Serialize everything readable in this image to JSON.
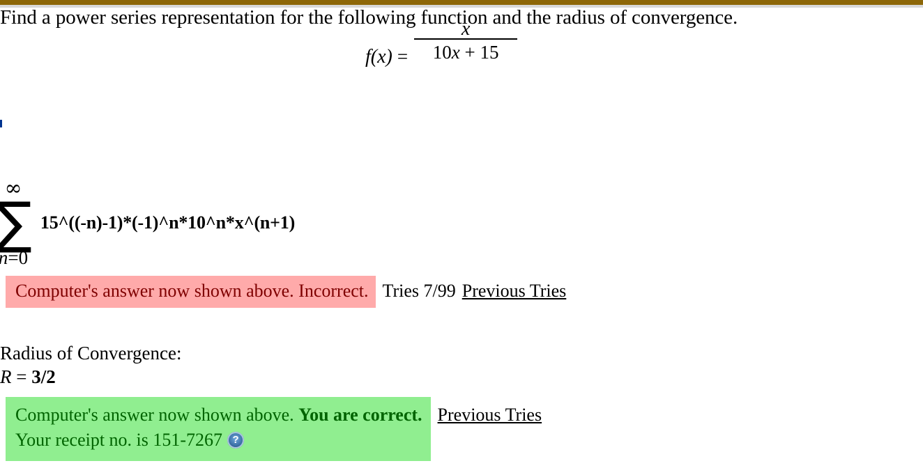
{
  "theme": {
    "top_bar_color": "#8d6708",
    "incorrect_bg": "#ffaaaa",
    "incorrect_text": "#7f0000",
    "correct_bg": "#90ee90",
    "correct_text": "#006400",
    "page_bg": "#ffffff"
  },
  "problem": {
    "prompt": "Find a power series representation for the following function and the radius of convergence.",
    "equation": {
      "lhs": "f(x)",
      "equals": "=",
      "numerator": "x",
      "denominator_coefficient": "10",
      "denominator_variable": "x",
      "denominator_plus": "+",
      "denominator_constant": "15"
    }
  },
  "answer_series": {
    "sigma_glyph": "∑",
    "upper_limit": "∞",
    "lower_index": "n",
    "lower_equals": "=",
    "lower_start": "0",
    "expression": "15^((-n)-1)*(-1)^n*10^n*x^(n+1)"
  },
  "incorrect_feedback": {
    "message": "Computer's answer now shown above. Incorrect.",
    "tries_label": "Tries 7/99",
    "previous_tries_link": "Previous Tries"
  },
  "radius_of_convergence": {
    "label": "Radius of Convergence:",
    "variable": "R",
    "equals": "=",
    "value": "3/2"
  },
  "correct_feedback": {
    "message_prefix": "Computer's answer now shown above.",
    "message_strong": "You are correct.",
    "receipt_line": "Your receipt no. is 151-7267",
    "help_icon": "question-mark-icon",
    "previous_tries_link": "Previous Tries"
  }
}
